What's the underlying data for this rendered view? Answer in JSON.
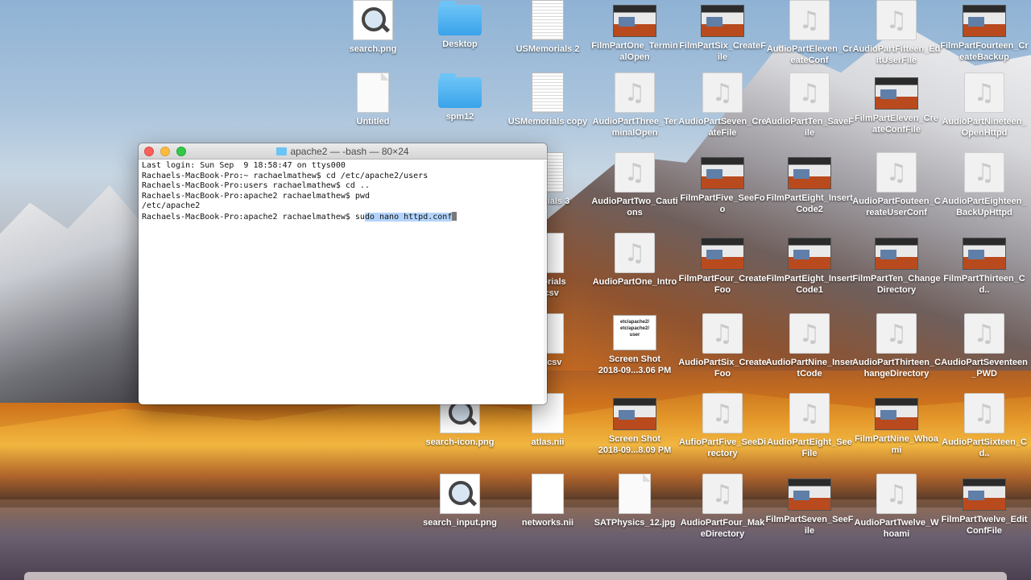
{
  "desktop_icons": [
    {
      "label": "search.png",
      "type": "mag"
    },
    {
      "label": "Desktop",
      "type": "folder"
    },
    {
      "label": "USMemorials 2",
      "type": "sheet"
    },
    {
      "label": "FilmPartOne_TerminalOpen",
      "type": "shot"
    },
    {
      "label": "FilmPartSix_CreateFile",
      "type": "shot"
    },
    {
      "label": "AudioPartEleven_CreateConf",
      "type": "audio"
    },
    {
      "label": "AudioPartFifteen_EditUserFile",
      "type": "audio"
    },
    {
      "label": "FilmPartFourteen_CreateBackup",
      "type": "shot"
    },
    {
      "label": "Untitled",
      "type": "doc"
    },
    {
      "label": "spm12",
      "type": "folder"
    },
    {
      "label": "USMemorials copy",
      "type": "sheet"
    },
    {
      "label": "AudioPartThree_TerminalOpen",
      "type": "audio"
    },
    {
      "label": "AudioPartSeven_CreateFile",
      "type": "audio"
    },
    {
      "label": "AudioPartTen_SaveFile",
      "type": "audio"
    },
    {
      "label": "FilmPartEleven_CreateConfFile",
      "type": "shot"
    },
    {
      "label": "AudioPartNineteen_OpenHttpd",
      "type": "audio"
    },
    {
      "label": "emorials 3",
      "type": "sheet"
    },
    {
      "label": "AudioPartTwo_Cautions",
      "type": "audio"
    },
    {
      "label": "FilmPartFive_SeeFoo",
      "type": "shot"
    },
    {
      "label": "FilmPartEight_InsertCode2",
      "type": "shot"
    },
    {
      "label": "AudioPartFouteen_CreateUserConf",
      "type": "audio"
    },
    {
      "label": "AudioPartEighteen_BackUpHttpd",
      "type": "audio"
    },
    {
      "label": "emorials\n7.csv",
      "type": "white"
    },
    {
      "label": "AudioPartOne_Intro",
      "type": "audio"
    },
    {
      "label": "FilmPartFour_CreateFoo",
      "type": "shot"
    },
    {
      "label": "FilmPartEight_InsertCode1",
      "type": "shot"
    },
    {
      "label": "FilmPartTen_ChangeDirectory",
      "type": "shot"
    },
    {
      "label": "FilmPartThirteen_Cd..",
      "type": "shot"
    },
    {
      "label": "IIS.csv",
      "type": "white"
    },
    {
      "label": "Screen Shot\n2018-09...3.06 PM",
      "type": "note"
    },
    {
      "label": "AudioPartSix_CreateFoo",
      "type": "audio"
    },
    {
      "label": "AudioPartNine_InsertCode",
      "type": "audio"
    },
    {
      "label": "AudioPartThirteen_ChangeDirectory",
      "type": "audio"
    },
    {
      "label": "AudioPartSeventeen_PWD",
      "type": "audio"
    },
    {
      "label": "search-icon.png",
      "type": "mag"
    },
    {
      "label": "atlas.nii",
      "type": "white"
    },
    {
      "label": "Screen Shot\n2018-09...8.09 PM",
      "type": "shot"
    },
    {
      "label": "AufioPartFive_SeeDirectory",
      "type": "audio"
    },
    {
      "label": "AudioPartEight_SeeFile",
      "type": "audio"
    },
    {
      "label": "FilmPartNine_Whoami",
      "type": "shot"
    },
    {
      "label": "AudioPartSixteen_Cd..",
      "type": "audio"
    },
    {
      "label": "search_input.png",
      "type": "mag"
    },
    {
      "label": "networks.nii",
      "type": "white"
    },
    {
      "label": "SATPhysics_12.jpg",
      "type": "doc"
    },
    {
      "label": "AudioPartFour_MakeDirectory",
      "type": "audio"
    },
    {
      "label": "FilmPartSeven_SeeFile",
      "type": "shot"
    },
    {
      "label": "AudioPartTwelve_Whoami",
      "type": "audio"
    },
    {
      "label": "FilmPartTwelve_EditConfFile",
      "type": "shot"
    }
  ],
  "note_icon_text": "etc/apache2/\netc/apache2/\nuser",
  "terminal": {
    "title": "apache2 — -bash — 80×24",
    "lines": [
      "Last login: Sun Sep  9 18:58:47 on ttys000",
      "Rachaels-MacBook-Pro:~ rachaelmathew$ cd /etc/apache2/users",
      "Rachaels-MacBook-Pro:users rachaelmathew$ cd ..",
      "Rachaels-MacBook-Pro:apache2 rachaelmathew$ pwd",
      "/etc/apache2"
    ],
    "prompt": "Rachaels-MacBook-Pro:apache2 rachaelmathew$ ",
    "command_plain": "su",
    "command_selected": "do nano httpd.conf"
  },
  "colors": {
    "selection": "#b3d4fc",
    "close": "#fc605b",
    "minimize": "#fdbc40",
    "maximize": "#34c84a",
    "folder": "#6cc4f6"
  }
}
